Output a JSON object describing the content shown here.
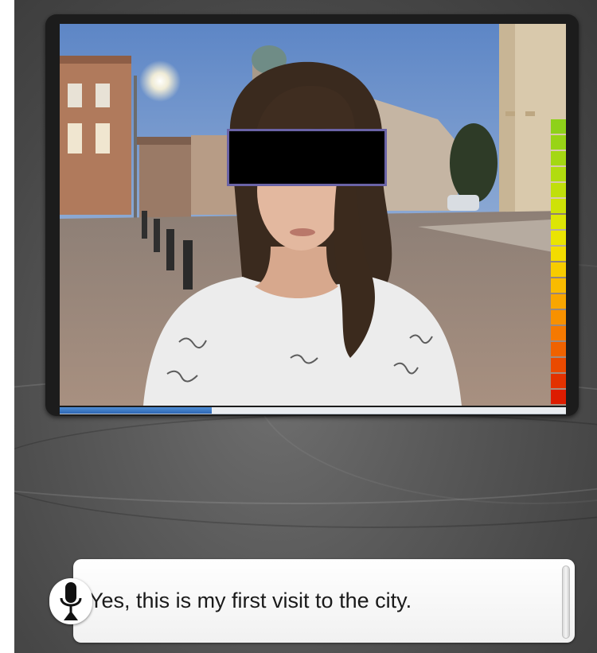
{
  "app": {
    "caption": {
      "text": "Yes, this is my first visit to the city.",
      "mic_icon": "microphone-icon"
    },
    "video": {
      "playback_progress": 0.3,
      "face_redaction_color": "#000000",
      "level_meter": {
        "segments": 18,
        "colors": [
          "#8ed11a",
          "#98d416",
          "#a4d812",
          "#b1dc0f",
          "#c0df0b",
          "#cee207",
          "#dde505",
          "#eae403",
          "#f3dc00",
          "#f7cc00",
          "#f9bb00",
          "#f9a600",
          "#f79100",
          "#f57900",
          "#f06200",
          "#ea4a00",
          "#e33200",
          "#dd1c00"
        ]
      }
    }
  }
}
